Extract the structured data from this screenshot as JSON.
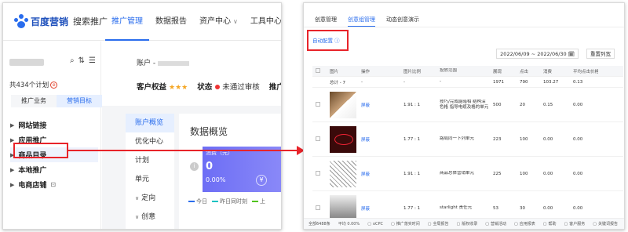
{
  "left": {
    "brand": {
      "logo_text": "百度营销",
      "product": "搜索推广"
    },
    "nav": [
      {
        "label": "推广管理",
        "active": true,
        "chevron": false
      },
      {
        "label": "数据报告",
        "active": false,
        "chevron": false
      },
      {
        "label": "资产中心",
        "active": false,
        "chevron": true
      },
      {
        "label": "工具中心",
        "active": false,
        "chevron": true
      }
    ],
    "sidebar": {
      "plan_count": "共434个计划",
      "count_badge": "ⓔ",
      "tabs": [
        {
          "label": "推广业务",
          "active": false
        },
        {
          "label": "营销目标",
          "active": true
        }
      ],
      "tree": [
        {
          "label": "网站链接",
          "selected": false,
          "ext": ""
        },
        {
          "label": "应用推广",
          "selected": false,
          "ext": ""
        },
        {
          "label": "商品目录",
          "selected": true,
          "ext": ""
        },
        {
          "label": "本地推广",
          "selected": false,
          "ext": ""
        },
        {
          "label": "电商店铺",
          "selected": false,
          "ext": "⊡"
        }
      ]
    },
    "account": {
      "account_label": "账户 -",
      "rights_label": "客户权益",
      "stars": "★★★",
      "status_label": "状态",
      "status_value": "未通过审核",
      "extra_label": "推广"
    },
    "sub_nav": [
      {
        "label": "账户概览",
        "active": true,
        "chevron": ""
      },
      {
        "label": "优化中心",
        "active": false,
        "chevron": ""
      },
      {
        "label": "计划",
        "active": false,
        "chevron": ""
      },
      {
        "label": "单元",
        "active": false,
        "chevron": ""
      },
      {
        "label": "定向",
        "active": false,
        "chevron": "∨"
      },
      {
        "label": "创意",
        "active": false,
        "chevron": "∨"
      }
    ],
    "overview": {
      "title": "数据概览",
      "card_label": "消费（元）",
      "card_value": "0",
      "card_pct": "0.00%",
      "card_symbol": "¥",
      "legend": [
        {
          "label": "今日",
          "color": "#2a6ded"
        },
        {
          "label": "昨日同时刻",
          "color": "#13c2c2"
        },
        {
          "label": "上",
          "color": "#52c41a"
        }
      ]
    }
  },
  "right": {
    "tabs": [
      {
        "label": "创意管理",
        "active": false
      },
      {
        "label": "创意组管理",
        "active": true
      },
      {
        "label": "动态创意演示",
        "active": false
      }
    ],
    "auto_link": "自动配置 ⓘ",
    "date_range": "2022/06/09 ~ 2022/06/30 🗓",
    "reset_button": "重置列宽",
    "columns": [
      "",
      "图片",
      "操作",
      "图片比例",
      "投放范围",
      "展现",
      "点击",
      "消费",
      "平均点击价格"
    ],
    "summary": [
      "",
      "总计 - 7",
      "-",
      "-",
      "-",
      "1971",
      "790",
      "103.27",
      "0.13"
    ],
    "rows": [
      {
        "thumb": "t1",
        "op": "屏蔽",
        "ratio": "1.91 : 1",
        "scope": "技巧/完成能暗相 结构深色格 指导电缆及格的单元",
        "shows": "500",
        "clicks": "20",
        "cost": "0.15",
        "cpc": "0.00"
      },
      {
        "thumb": "t2",
        "op": "屏蔽",
        "ratio": "1.77 : 1",
        "scope": "路局同一下列单元",
        "shows": "223",
        "clicks": "100",
        "cost": "0.00",
        "cpc": "0.00"
      },
      {
        "thumb": "t3",
        "op": "屏蔽",
        "ratio": "1.91 : 1",
        "scope": "商品总体营销单元",
        "shows": "225",
        "clicks": "100",
        "cost": "0.00",
        "cpc": "0.00"
      },
      {
        "thumb": "t4",
        "op": "屏蔽",
        "ratio": "1.77 : 1",
        "scope": "starlight 责任元",
        "shows": "53",
        "clicks": "30",
        "cost": "0.00",
        "cpc": "0.00"
      }
    ],
    "footer": [
      "全部6488条",
      "平均 0.00%",
      "oCPC",
      "推广落实时间",
      "全局报告",
      "版权收录",
      "营销活动",
      "应用报表",
      "帮助",
      "客户服务",
      "关键词报告"
    ]
  }
}
